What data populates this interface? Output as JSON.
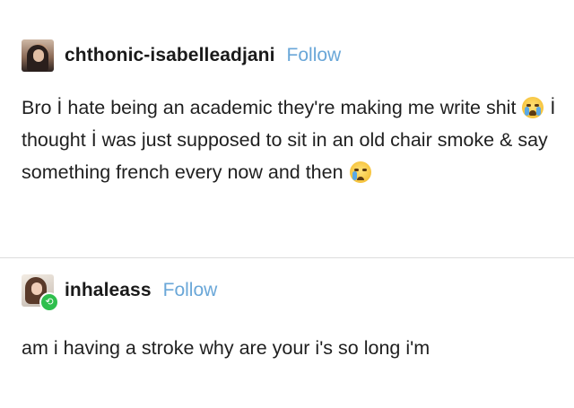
{
  "posts": [
    {
      "username": "chthonic-isabelleadjani",
      "follow_label": "Follow",
      "segments": [
        "Bro İ hate being an academic they're making me write shit ",
        " İ thought İ was just supposed to sit in an old chair smoke & say something french every now and then "
      ],
      "emoji": [
        "loudly-crying-face-icon",
        "crying-face-icon"
      ]
    },
    {
      "username": "inhaleass",
      "follow_label": "Follow",
      "body": "am i having a stroke why are your i's so long i'm",
      "badge_icon": "reblog-icon"
    }
  ],
  "colors": {
    "follow": "#6aa7d8",
    "text": "#1f1f1f",
    "divider": "#dcdcdc",
    "reblog_badge": "#2fbf4d"
  }
}
